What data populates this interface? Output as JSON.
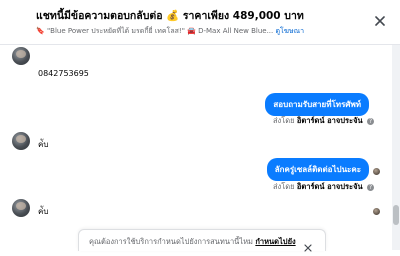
{
  "header": {
    "title": "แชทนี้มีข้อความตอบกลับต่อ 💰 ราคาเพียง 489,000 บาท",
    "subtitle": "🔖 \"Blue Power ประหยัดที่ได้ มรดกี้ยี่ เทคโลส!\" 🚘 D-Max All New Blue...",
    "subtitle_link": "ดูโฆษณา",
    "close_icon": "close-icon"
  },
  "messages": [
    {
      "type": "incoming",
      "text": "0842753695"
    },
    {
      "type": "outgoing",
      "text": "สอบถามรับสายที่โทรศัพท์",
      "sent_by_label": "ส่งโดย",
      "sent_by_name": "อิตาร์ดน์ อาจประจัน"
    },
    {
      "type": "incoming",
      "text": "ค่ับ"
    },
    {
      "type": "outgoing",
      "text": "ลักครู่เซลล์ติดต่อไปนะคะ",
      "sent_by_label": "ส่งโดย",
      "sent_by_name": "อิตาร์ดน์ อาจประจัน"
    },
    {
      "type": "incoming",
      "text": "ค่ับ"
    }
  ],
  "notice": {
    "text": "คุณต้องการใช้บริการกำหนดไปยังการสนทนานี้ไหม",
    "link": "กำหนดไปยัง"
  },
  "colors": {
    "accent": "#0a7cff",
    "link": "#0064d1",
    "muted": "#65676b"
  }
}
